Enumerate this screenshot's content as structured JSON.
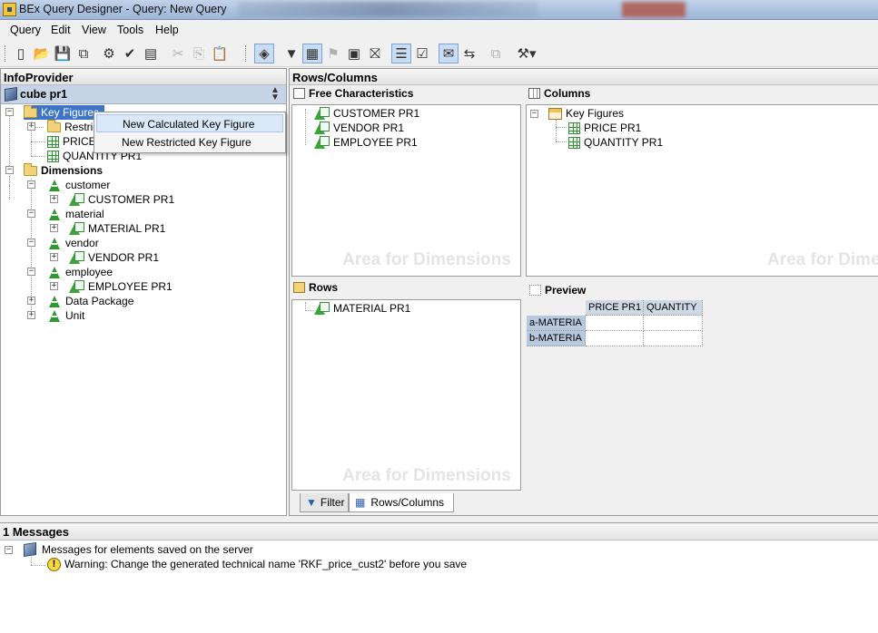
{
  "window": {
    "title": "BEx Query Designer - Query: New Query"
  },
  "menu": [
    "Query",
    "Edit",
    "View",
    "Tools",
    "Help"
  ],
  "infoprovider": {
    "header": "InfoProvider",
    "cube": "cube pr1",
    "tree": {
      "key_figures": "Key Figures",
      "restricted": "Restric",
      "price": "PRICE",
      "quantity": "QUANTITY PR1",
      "dimensions": "Dimensions",
      "dims": [
        {
          "label": "customer",
          "child": "CUSTOMER PR1"
        },
        {
          "label": "material",
          "child": "MATERIAL PR1"
        },
        {
          "label": "vendor",
          "child": "VENDOR  PR1"
        },
        {
          "label": "employee",
          "child": "EMPLOYEE PR1"
        }
      ],
      "data_package": "Data Package",
      "unit": "Unit"
    }
  },
  "context_menu": {
    "items": [
      "New Calculated Key Figure",
      "New Restricted Key Figure"
    ]
  },
  "rows_columns": {
    "header": "Rows/Columns",
    "free_characteristics": {
      "title": "Free Characteristics",
      "items": [
        "CUSTOMER PR1",
        "VENDOR  PR1",
        "EMPLOYEE PR1"
      ]
    },
    "columns": {
      "title": "Columns",
      "group": "Key Figures",
      "items": [
        "PRICE PR1",
        "QUANTITY PR1"
      ]
    },
    "rows": {
      "title": "Rows",
      "items": [
        "MATERIAL PR1"
      ]
    },
    "watermark": "Area for Dimensions",
    "preview": {
      "title": "Preview",
      "col_headers": [
        "PRICE PR1",
        "QUANTITY"
      ],
      "row_headers": [
        "a-MATERIA",
        "b-MATERIA"
      ]
    }
  },
  "tabs": [
    "Filter",
    "Rows/Columns"
  ],
  "messages": {
    "header": "1 Messages",
    "root": "Messages for elements saved on the server",
    "warning": "Warning: Change the generated technical name 'RKF_price_cust2' before you save"
  }
}
